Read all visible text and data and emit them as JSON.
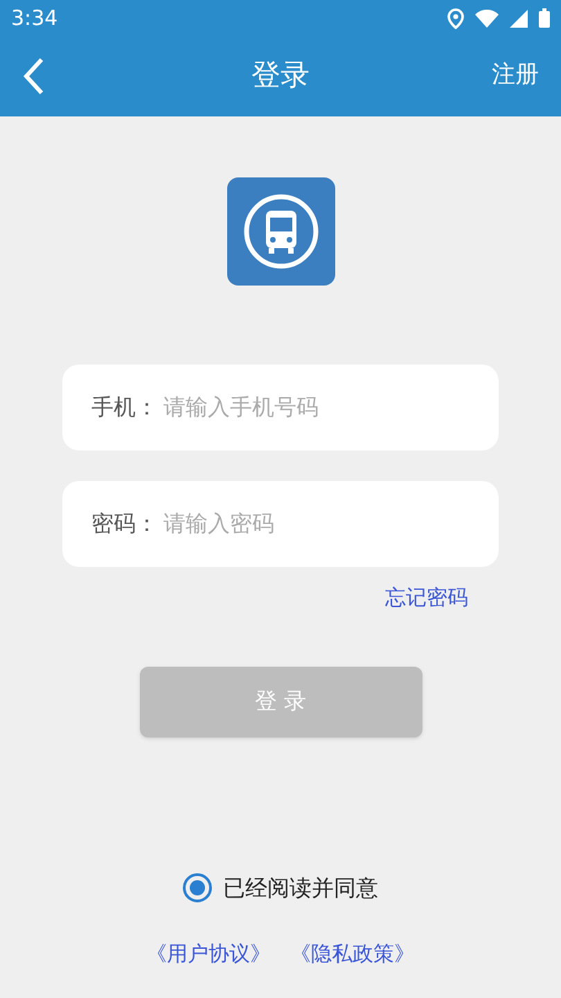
{
  "status_bar": {
    "time": "3:34"
  },
  "header": {
    "title": "登录",
    "action": "注册"
  },
  "fields": [
    {
      "label": "手机：",
      "placeholder": "请输入手机号码"
    },
    {
      "label": "密码：",
      "placeholder": "请输入密码"
    }
  ],
  "forgot_password": "忘记密码",
  "login_button": {
    "label": "登 录",
    "disabled": true
  },
  "agreement": {
    "text": "已经阅读并同意",
    "checked": true
  },
  "links": [
    "《用户协议》",
    "《隐私政策》"
  ]
}
